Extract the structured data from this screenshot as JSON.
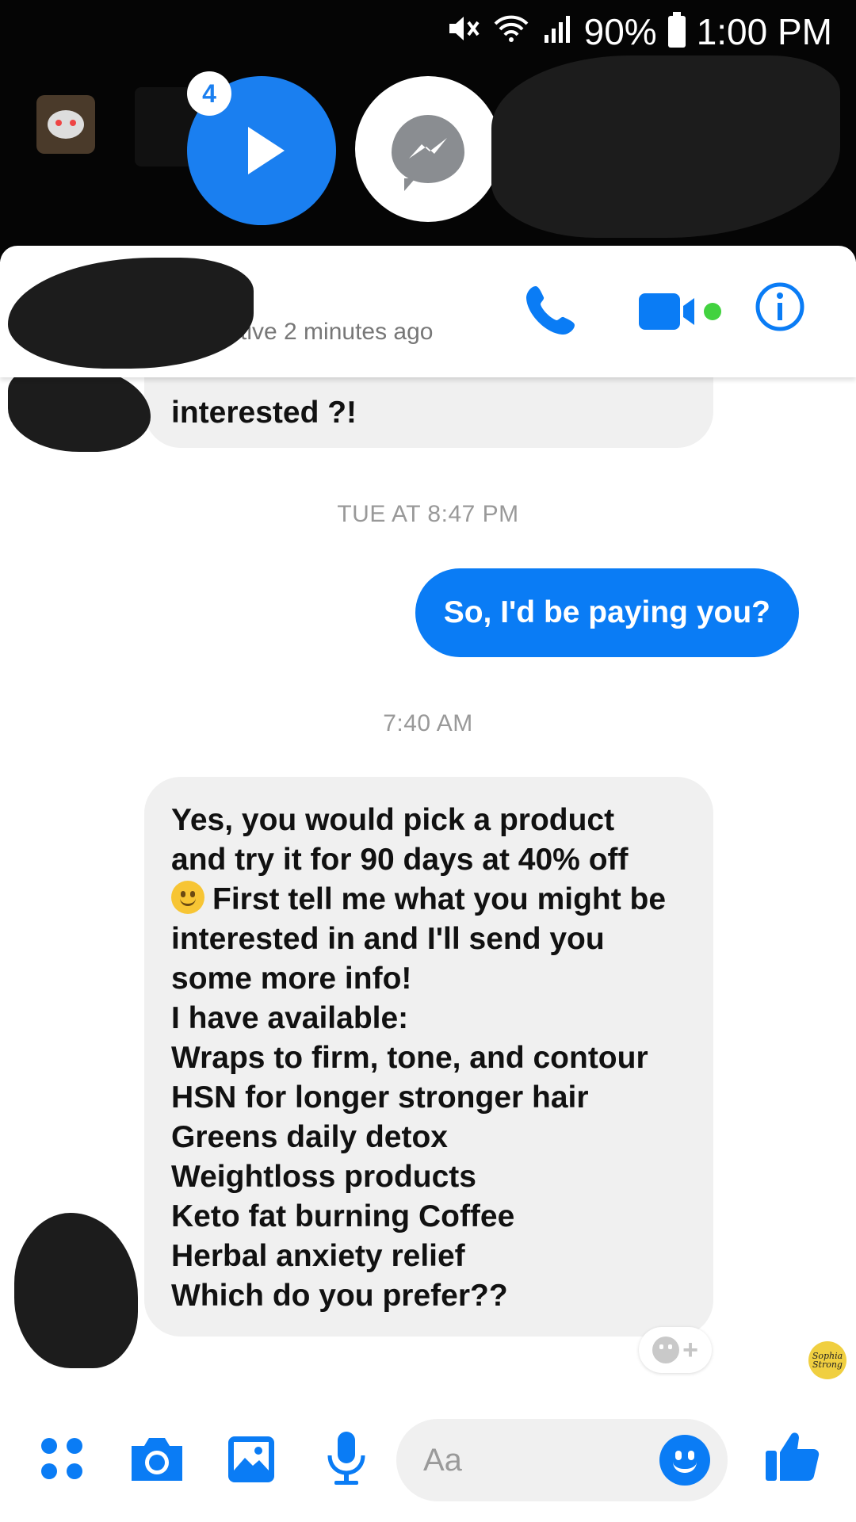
{
  "status_bar": {
    "battery": "90%",
    "time": "1:00 PM"
  },
  "chat_heads": {
    "unread_badge": "4"
  },
  "chat_header": {
    "active_status": "Active 2 minutes ago"
  },
  "messages": {
    "previous_fragment": "interested ?!",
    "timestamp_1": "TUE AT 8:47 PM",
    "outgoing_1": "So, I'd be paying you?",
    "timestamp_2": "7:40 AM",
    "incoming_lines": [
      "Yes, you would pick a product",
      "and try it for 90 days at 40% off",
      "First tell me what you might be",
      "interested in and I'll send you",
      "some more info!",
      "I have available:",
      "Wraps to firm, tone, and contour",
      "HSN for longer stronger hair",
      "Greens daily detox",
      "Weightloss products",
      "Keto fat burning Coffee",
      "Herbal anxiety relief",
      "Which do you prefer??"
    ]
  },
  "reaction_button": {
    "label": "+"
  },
  "seen_avatar": {
    "text": "Sophia Strong"
  },
  "composer": {
    "placeholder": "Aa"
  },
  "colors": {
    "messenger_blue": "#0a7cf5",
    "incoming_bubble": "#f0f0f0",
    "online_dot": "#42d23f"
  },
  "icons": [
    "mute-icon",
    "wifi-icon",
    "signal-icon",
    "battery-icon",
    "play-icon",
    "messenger-icon",
    "phone-icon",
    "video-icon",
    "info-icon",
    "apps-icon",
    "camera-icon",
    "gallery-icon",
    "mic-icon",
    "emoji-icon",
    "like-icon"
  ]
}
